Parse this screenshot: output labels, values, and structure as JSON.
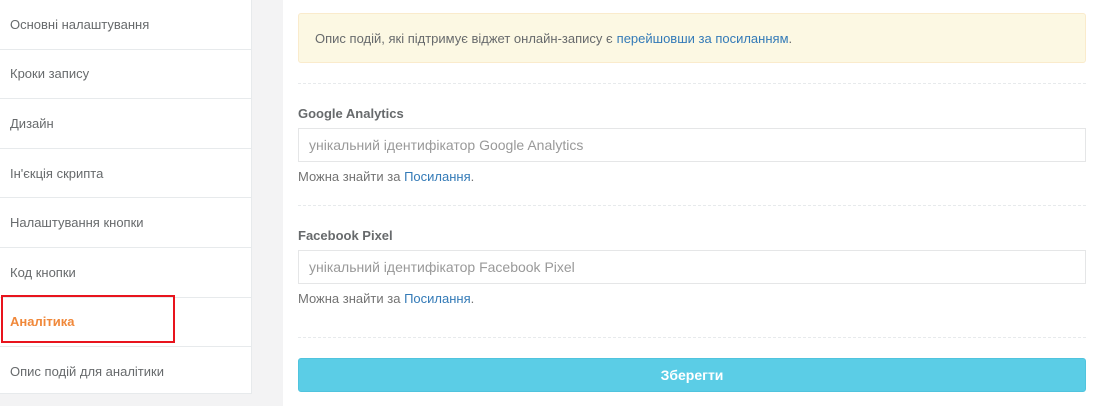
{
  "sidebar": {
    "items": [
      {
        "label": "Основні налаштування"
      },
      {
        "label": "Кроки запису"
      },
      {
        "label": "Дизайн"
      },
      {
        "label": "Ін'єкція скрипта"
      },
      {
        "label": "Налаштування кнопки"
      },
      {
        "label": "Код кнопки"
      },
      {
        "label": "Аналітика"
      },
      {
        "label": "Опис подій для аналітики"
      }
    ],
    "active_color": "#f0883a",
    "highlight_color": "#e8141d"
  },
  "main": {
    "alert": {
      "text": "Опис подій, які підтримує віджет онлайн-запису є",
      "link": "перейшовши за посиланням",
      "suffix": "."
    },
    "google_analytics": {
      "label": "Google Analytics",
      "placeholder": "унікальний ідентифікатор Google Analytics",
      "value": "",
      "help_text": "Можна знайти за",
      "help_link": "Посилання",
      "help_suffix": "."
    },
    "facebook_pixel": {
      "label": "Facebook Pixel",
      "placeholder": "унікальний ідентифікатор Facebook Pixel",
      "value": "",
      "help_text": "Можна знайти за",
      "help_link": "Посилання",
      "help_suffix": "."
    },
    "save_label": "Зберегти",
    "save_color": "#5bcde6"
  }
}
